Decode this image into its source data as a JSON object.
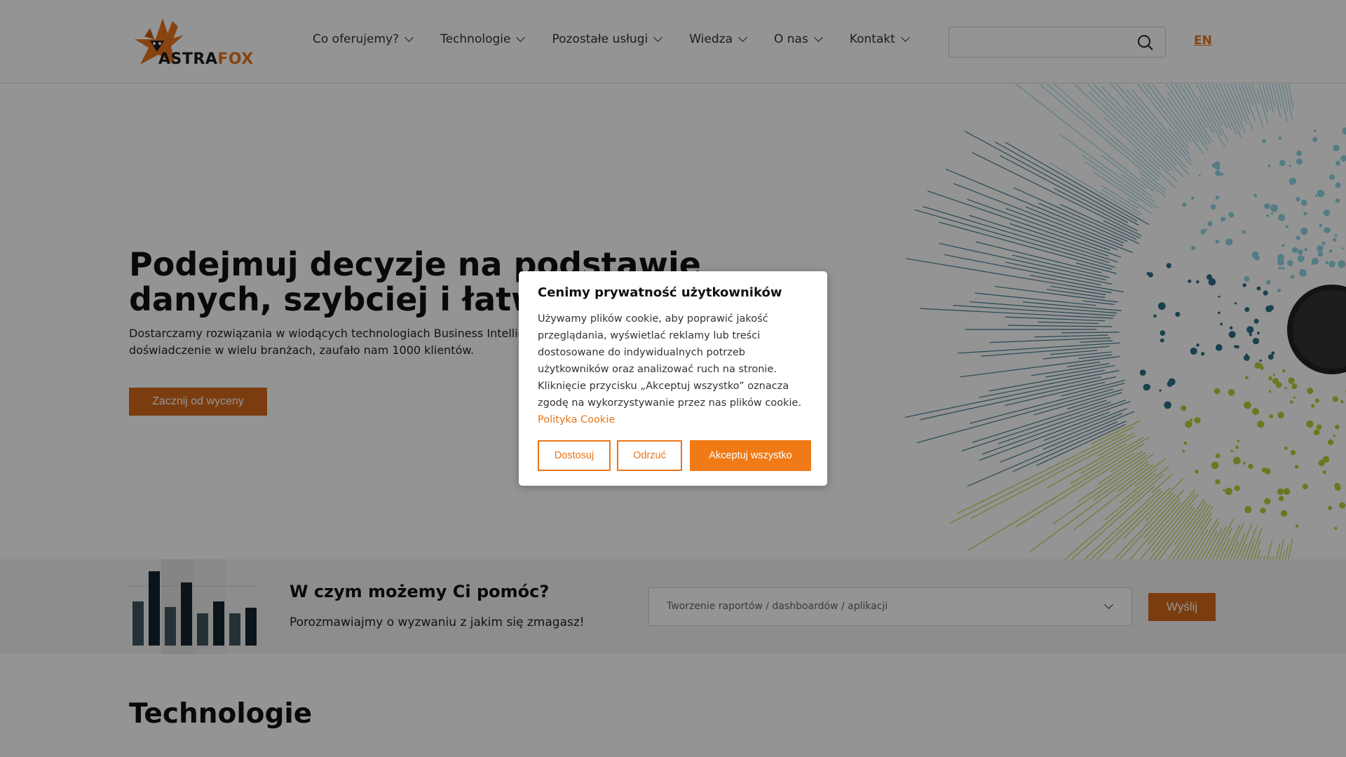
{
  "brand": {
    "part1": "ASTRA",
    "part2": "FOX",
    "accent": "#e8761c"
  },
  "nav": [
    {
      "label": "Co oferujemy?"
    },
    {
      "label": "Technologie"
    },
    {
      "label": "Pozostałe usługi"
    },
    {
      "label": "Wiedza"
    },
    {
      "label": "O nas"
    },
    {
      "label": "Kontakt"
    }
  ],
  "search": {
    "placeholder": "",
    "icon": "search-icon"
  },
  "language": "EN",
  "hero": {
    "title": "Podejmuj decyzje na podstawie danych, szybciej i łatwiej",
    "subtitle": "Dostarczamy rozwiązania w wiodących technologiach Business Intelligence. Posiadamy doświadczenie w wielu branżach, zaufało nam 1000 klientów.",
    "cta": "Zacznij od wyceny"
  },
  "help": {
    "title": "W czym możemy Ci pomóc?",
    "subtitle": "Porozmawiajmy o wyzwaniu z jakim się zmagasz!",
    "selected": "Tworzenie raportów / dashboardów / aplikacji",
    "send": "Wyślij"
  },
  "tech": {
    "title": "Technologie"
  },
  "cookie": {
    "title": "Cenimy prywatność użytkowników",
    "body": "Używamy plików cookie, aby poprawić jakość przeglądania, wyświetlać reklamy lub treści dostosowane do indywidualnych potrzeb użytkowników oraz analizować ruch na stronie. Kliknięcie przycisku „Akceptuj wszystko” oznacza zgodę na wykorzystywanie przez nas plików cookie.",
    "policy_link": "Polityka Cookie",
    "customize": "Dostosuj",
    "reject": "Odrzuć",
    "accept": "Akceptuj wszystko"
  }
}
